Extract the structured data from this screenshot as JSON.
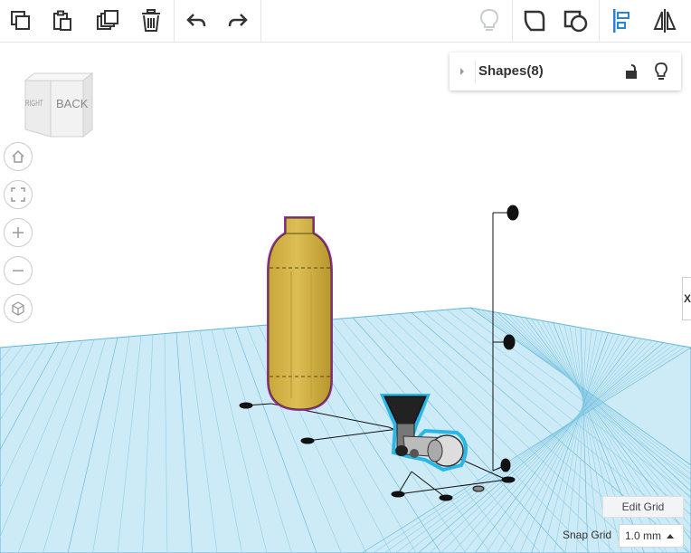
{
  "toolbar": {
    "buttons": [
      {
        "name": "copy-icon"
      },
      {
        "name": "paste-icon"
      },
      {
        "name": "duplicate-icon"
      },
      {
        "name": "delete-icon"
      },
      {
        "name": "undo-icon"
      },
      {
        "name": "redo-icon"
      },
      {
        "name": "lightbulb-icon"
      },
      {
        "name": "group-icon"
      },
      {
        "name": "ungroup-icon"
      },
      {
        "name": "align-icon"
      },
      {
        "name": "mirror-icon"
      }
    ]
  },
  "view_cube": {
    "front_label": "BACK",
    "side_label": "RIGHT"
  },
  "nav_controls": [
    {
      "name": "home-view-icon"
    },
    {
      "name": "fit-view-icon"
    },
    {
      "name": "zoom-in-icon"
    },
    {
      "name": "zoom-out-icon"
    },
    {
      "name": "perspective-icon"
    }
  ],
  "shapes_panel": {
    "title": "Shapes(8)",
    "icons": [
      "caret-right-icon",
      "unlock-icon",
      "lightbulb-icon"
    ]
  },
  "bottom": {
    "edit_grid_label": "Edit Grid",
    "snap_grid_label": "Snap Grid",
    "snap_grid_value": "1.0 mm"
  },
  "colors": {
    "grid": "#a9dcef",
    "grid_major": "#5fb6d9",
    "bottle": "#d4b447",
    "selection_outline": "#9b2ab5",
    "selected_part": "#2bb6e8",
    "accent": "#2a86d4"
  },
  "side_tab_label": "X"
}
